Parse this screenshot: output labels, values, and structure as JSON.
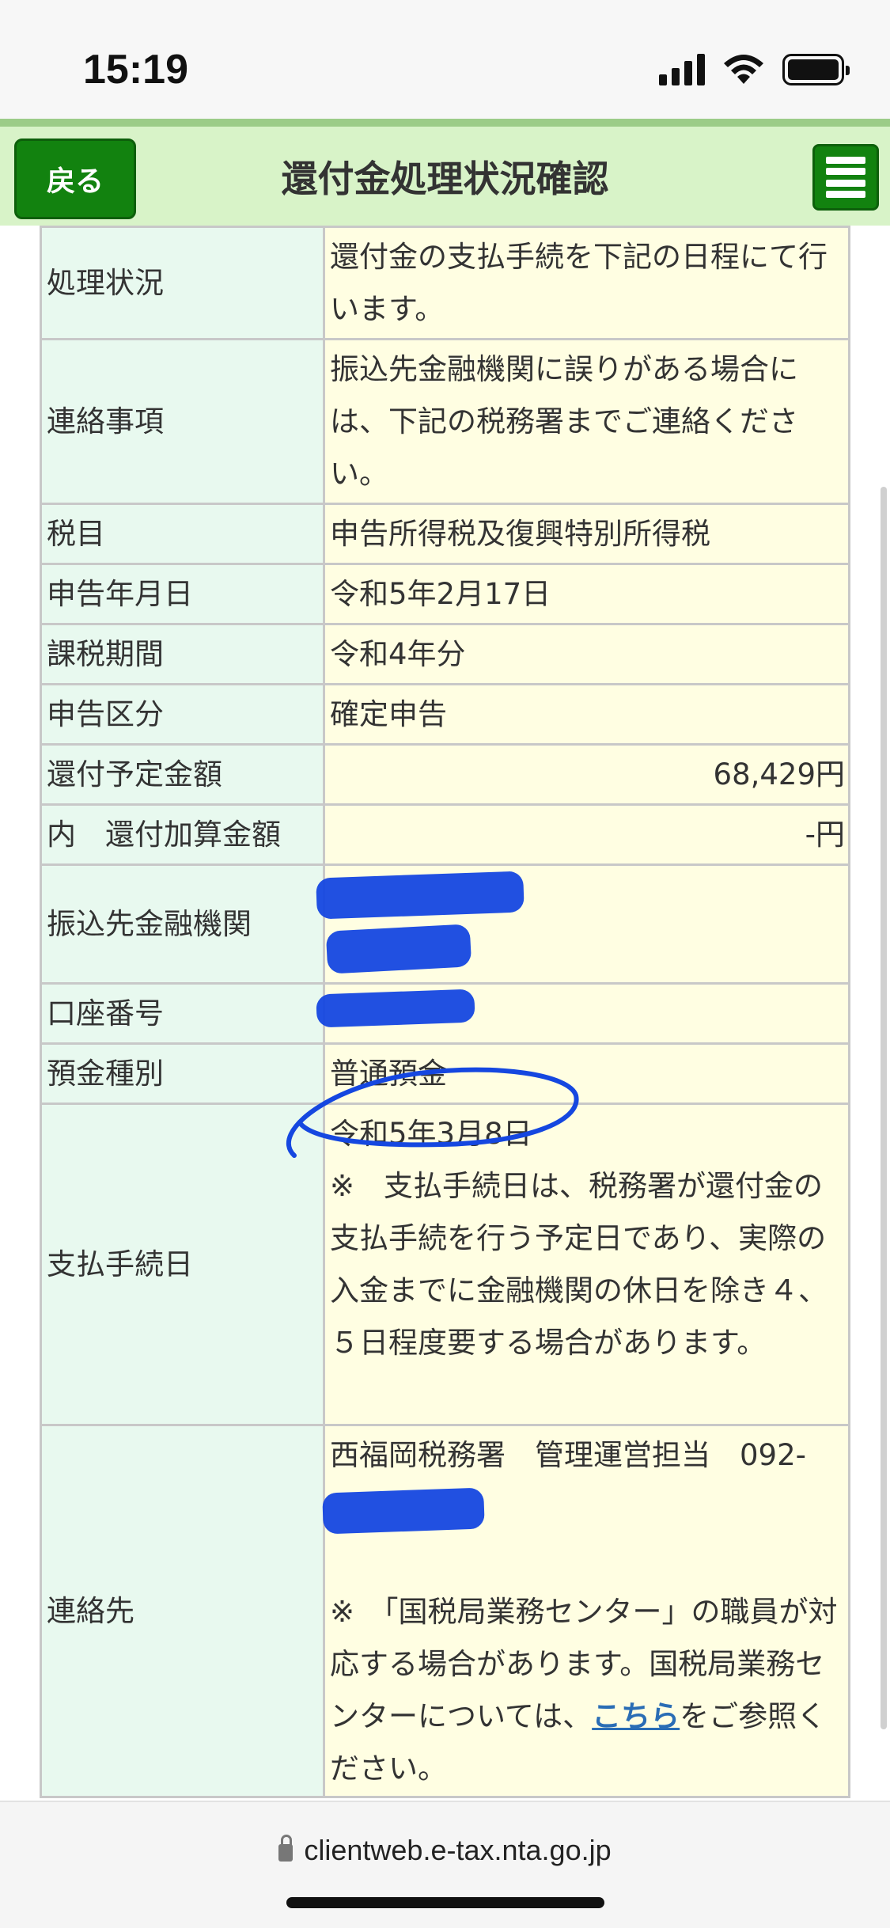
{
  "status_bar": {
    "time": "15:19"
  },
  "header": {
    "back_label": "戻る",
    "title": "還付金処理状況確認"
  },
  "rows": [
    {
      "label": "処理状況",
      "value": "還付金の支払手続を下記の日程にて行います。"
    },
    {
      "label": "連絡事項",
      "value": "振込先金融機関に誤りがある場合には、下記の税務署までご連絡ください。"
    },
    {
      "label": "税目",
      "value": "申告所得税及復興特別所得税"
    },
    {
      "label": "申告年月日",
      "value": "令和5年2月17日"
    },
    {
      "label": "課税期間",
      "value": "令和4年分"
    },
    {
      "label": "申告区分",
      "value": "確定申告"
    },
    {
      "label": "還付予定金額",
      "value": "68,429円"
    },
    {
      "label": "内　還付加算金額",
      "value": "-円"
    },
    {
      "label": "振込先金融機関",
      "value": ""
    },
    {
      "label": "口座番号",
      "value": ""
    },
    {
      "label": "預金種別",
      "value": "普通預金"
    },
    {
      "label": "支払手続日",
      "date": "令和5年3月8日",
      "note": "※　支払手続日は、税務署が還付金の支払手続を行う予定日であり、実際の入金までに金融機関の休日を除き４、５日程度要する場合があります。"
    },
    {
      "label": "連絡先",
      "office": "西福岡税務署　管理運営担当　092-",
      "note_before": "※　「国税局業務センター」の職員が対応する場合があります。国税局業務センターについては、",
      "link": "こちら",
      "note_after": "をご参照ください。"
    }
  ],
  "url_bar": {
    "url": "clientweb.e-tax.nta.go.jp"
  },
  "colors": {
    "header_bg": "#d8f3c8",
    "button_green": "#12820f",
    "label_bg": "#e8f9ef",
    "value_bg": "#fffee2",
    "redaction": "#1547e0"
  }
}
